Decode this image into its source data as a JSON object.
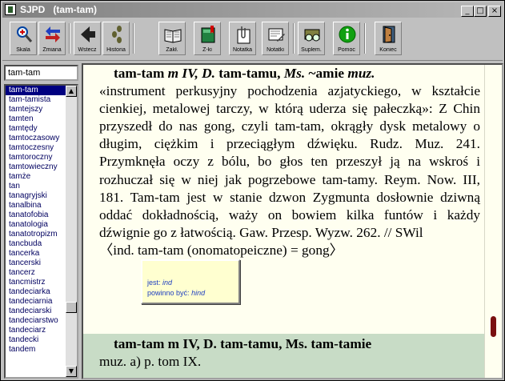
{
  "window": {
    "title": "SJPD   (tam-tam)"
  },
  "toolbar": {
    "buttons": [
      {
        "label": "Skala",
        "icon": "magnifier-plus-icon"
      },
      {
        "label": "Zmiana",
        "icon": "swap-arrows-icon"
      },
      {
        "label": "Wstecz",
        "icon": "back-arrow-icon"
      },
      {
        "label": "Historia",
        "icon": "history-footprints-icon"
      },
      {
        "label": "Zakł.",
        "icon": "open-book-icon"
      },
      {
        "label": "Z-ki",
        "icon": "bookmark-book-icon"
      },
      {
        "label": "Notatka",
        "icon": "paperclip-note-icon"
      },
      {
        "label": "Notatki",
        "icon": "notes-pencil-icon"
      },
      {
        "label": "Suplem.",
        "icon": "supplement-book-glasses-icon"
      },
      {
        "label": "Pomoc",
        "icon": "help-info-icon"
      },
      {
        "label": "Koniec",
        "icon": "exit-door-icon"
      }
    ]
  },
  "search": {
    "value": "tam-tam"
  },
  "wordlist": [
    "tam-tam",
    "tam-tamista",
    "tamtejszy",
    "tamten",
    "tamtędy",
    "tamtoczasowy",
    "tamtoczesny",
    "tamtoroczny",
    "tamtowieczny",
    "tamże",
    "tan",
    "tanagryjski",
    "tanalbina",
    "tanatofobia",
    "tanatologia",
    "tanatotropizm",
    "tancbuda",
    "tancerka",
    "tancerski",
    "tancerz",
    "tancmistrz",
    "tandeciarka",
    "tandeciarnia",
    "tandeciarski",
    "tandeciarstwo",
    "tandeciarz",
    "tandecki",
    "tandem"
  ],
  "entry1": {
    "line1": [
      "tam-tam ",
      " m IV, D. ",
      "tam-tamu, ",
      "Ms. ",
      "~amie ",
      "muz."
    ],
    "text": "«instrument perkusyjny pochodzenia azjatyckiego, w kształcie cienkiej, metalowej tarczy, w którą uderza się pałeczką»: Z Chin przyszedł do nas gong, czyli tam-tam, okrągły dysk metalowy o długim, ciężkim i przeciągłym dźwięku. Rudz. Muz. 241. Przymknęła oczy z bólu, bo głos ten przeszył ją na wskroś i rozhuczał się w niej jak pogrzebowe tam-tamy. Reym. Now. III, 181. Tam-tam jest w stanie dzwon Zygmunta dosłownie dziwną oddać dokładnością, waży on bowiem kilka funtów i każdy dźwignie go z łatwością. Gaw. Przesp. Wyzw. 262. // SWil",
    "etym": "〈ind. tam-tam (onomatopeiczne) = gong〉"
  },
  "entry2": {
    "headword": "tam-tam",
    "grammar": " m IV, D. tam-tamu, Ms. tam-tamie",
    "line2": "muz. a) p. tom IX."
  },
  "tooltip": {
    "label1": "jest:",
    "value1": "ind",
    "label2": "powinno być:",
    "value2": "hind"
  },
  "colors": {
    "selection": "#000080",
    "content_bg": "#fffff0",
    "entry2_bg": "#c8dcc6",
    "tooltip_bg": "#ffffd0"
  }
}
